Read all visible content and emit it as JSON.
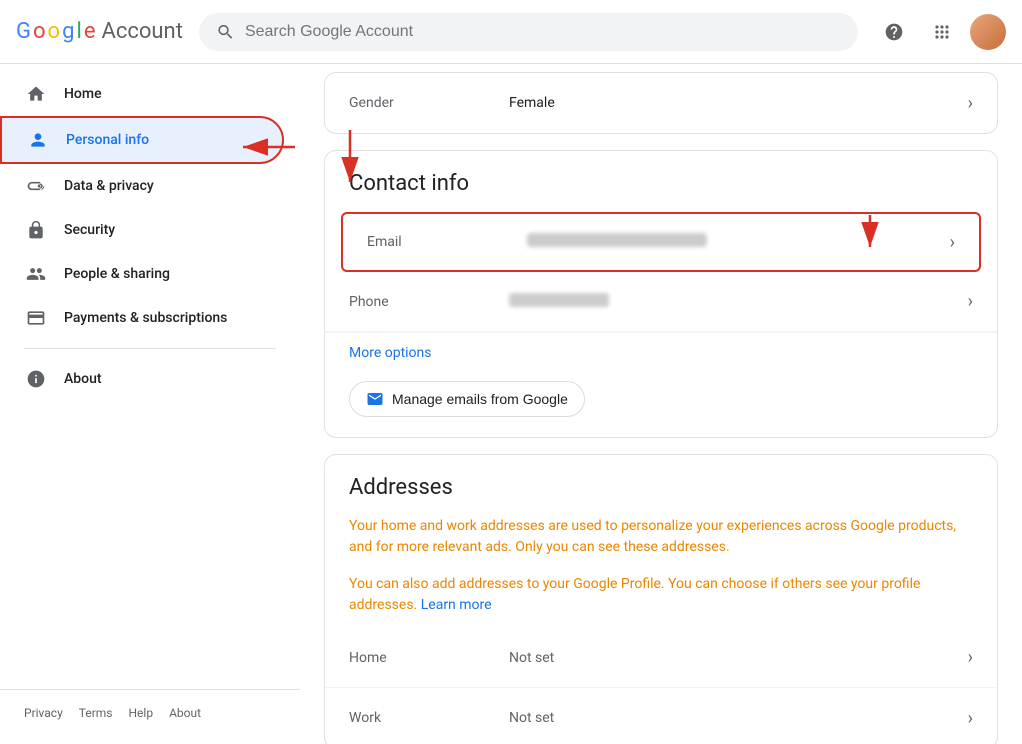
{
  "header": {
    "logo_google": "Google",
    "logo_account": "Account",
    "search_placeholder": "Search Google Account",
    "help_icon": "?",
    "apps_icon": "⋮⋮⋮"
  },
  "sidebar": {
    "items": [
      {
        "id": "home",
        "label": "Home",
        "icon": "home"
      },
      {
        "id": "personal-info",
        "label": "Personal info",
        "icon": "person",
        "active": true
      },
      {
        "id": "data-privacy",
        "label": "Data & privacy",
        "icon": "toggle"
      },
      {
        "id": "security",
        "label": "Security",
        "icon": "lock"
      },
      {
        "id": "people-sharing",
        "label": "People & sharing",
        "icon": "people"
      },
      {
        "id": "payments",
        "label": "Payments & subscriptions",
        "icon": "card"
      },
      {
        "id": "about",
        "label": "About",
        "icon": "info"
      }
    ],
    "footer": {
      "links": [
        "Privacy",
        "Terms",
        "Help",
        "About"
      ]
    }
  },
  "main": {
    "gender_label": "Gender",
    "gender_value": "Female",
    "contact_info_title": "Contact info",
    "email_label": "Email",
    "phone_label": "Phone",
    "more_options_label": "More options",
    "manage_emails_label": "Manage emails from Google",
    "addresses_title": "Addresses",
    "addresses_text1": "Your home and work addresses are used to personalize your experiences across Google products, and for more relevant ads. Only you can see these addresses.",
    "addresses_text2": "You can also add addresses to your Google Profile. You can choose if others see your profile addresses.",
    "learn_more": "Learn more",
    "home_label": "Home",
    "home_value": "Not set",
    "work_label": "Work",
    "work_value": "Not set"
  }
}
